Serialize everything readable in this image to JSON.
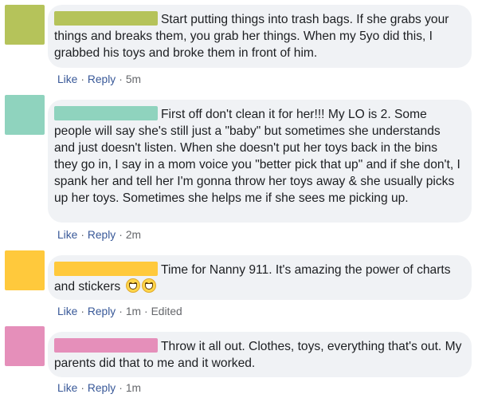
{
  "comments": [
    {
      "avatar_color": "#b5c35a",
      "name_color": "#b5c35a",
      "text": "Start putting things into trash bags. If she grabs your things and breaks them, you grab her things. When my 5yo did this, I grabbed his toys and broke them in front of him.",
      "like_label": "Like",
      "reply_label": "Reply",
      "time": "5m",
      "edited": ""
    },
    {
      "avatar_color": "#8fd3be",
      "name_color": "#8fd3be",
      "text": "First off don't clean it for her!!! My LO is 2. Some people will say she's still just a \"baby\" but sometimes she understands and just doesn't listen. When she doesn't put her toys back in the bins they go in, I say in a mom voice you \"better pick that up\" and if she don't, I spank her and tell  her I'm gonna throw her toys away & she usually picks up her toys. Sometimes she helps me if she sees me picking up.",
      "like_label": "Like",
      "reply_label": "Reply",
      "time": "2m",
      "edited": ""
    },
    {
      "avatar_color": "#ffc93c",
      "name_color": "#ffc93c",
      "text": "Time for Nanny 911. It's amazing the power of charts and stickers",
      "emoji_icon": "grinning-face-icon",
      "like_label": "Like",
      "reply_label": "Reply",
      "time": "1m",
      "edited": "Edited"
    },
    {
      "avatar_color": "#e58fba",
      "name_color": "#e58fba",
      "text": "Throw it all out. Clothes, toys, everything that's out. My parents did that to me and it worked.",
      "like_label": "Like",
      "reply_label": "Reply",
      "time": "1m",
      "edited": ""
    }
  ],
  "separator": "·"
}
